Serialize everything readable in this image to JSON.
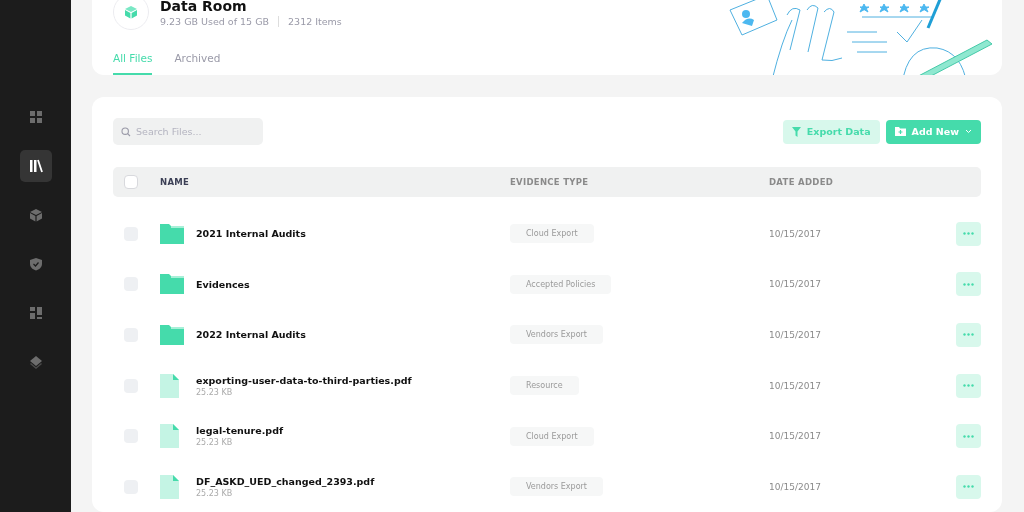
{
  "sidebar": {
    "items": [
      {
        "kind": "grid",
        "selected": false
      },
      {
        "kind": "library",
        "selected": true
      },
      {
        "kind": "cube",
        "selected": false
      },
      {
        "kind": "shield",
        "selected": false
      },
      {
        "kind": "dashboard",
        "selected": false
      },
      {
        "kind": "layers",
        "selected": false
      }
    ]
  },
  "header": {
    "title": "Data Room",
    "usage": "9.23 GB Used of 15 GB",
    "count": "2312 Items"
  },
  "tabs": [
    {
      "label": "All Files",
      "selected": true
    },
    {
      "label": "Archived",
      "selected": false
    }
  ],
  "search": {
    "placeholder": "Search Files..."
  },
  "buttons": {
    "export": "Export Data",
    "add": "Add New"
  },
  "table": {
    "checked": false,
    "columns": [
      "NAME",
      "EVIDENCE TYPE",
      "DATE ADDED"
    ],
    "rows": [
      {
        "kind": "folder",
        "name": "2021 Internal Audits",
        "evidence_type": "Cloud Export",
        "date": "10/15/2017",
        "checked": false
      },
      {
        "kind": "folder",
        "name": "Evidences",
        "evidence_type": "Accepted Policies",
        "date": "10/15/2017",
        "checked": false
      },
      {
        "kind": "folder",
        "name": "2022 Internal Audits",
        "evidence_type": "Vendors Export",
        "date": "10/15/2017",
        "checked": false
      },
      {
        "kind": "file",
        "name": "exporting-user-data-to-third-parties.pdf",
        "size": "25.23 KB",
        "evidence_type": "Resource",
        "date": "10/15/2017",
        "checked": false
      },
      {
        "kind": "file",
        "name": "legal-tenure.pdf",
        "size": "25.23 KB",
        "evidence_type": "Cloud Export",
        "date": "10/15/2017",
        "checked": false
      },
      {
        "kind": "file",
        "name": "DF_ASKD_UED_changed_2393.pdf",
        "size": "25.23 KB",
        "evidence_type": "Vendors Export",
        "date": "10/15/2017",
        "checked": false
      }
    ]
  }
}
